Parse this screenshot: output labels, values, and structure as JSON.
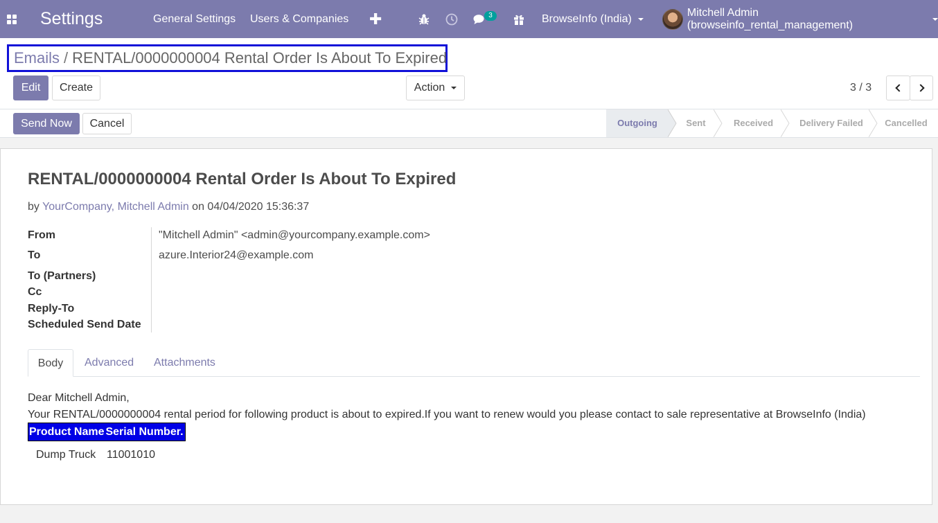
{
  "navbar": {
    "apps_icon": "apps-grid-icon",
    "brand": "Settings",
    "menus": [
      "General Settings",
      "Users & Companies"
    ],
    "plus_label": "✚",
    "systray": {
      "bug_icon": "bug-icon",
      "clock_icon": "clock-icon",
      "chat_icon": "chat-icon",
      "chat_badge": "3",
      "gift_icon": "gift-icon"
    },
    "company": "BrowseInfo (India)",
    "user": "Mitchell Admin (browseinfo_rental_management)"
  },
  "breadcrumb": {
    "parent": "Emails",
    "separator": "/",
    "current": "RENTAL/0000000004 Rental Order Is About To Expired"
  },
  "toolbar": {
    "edit_label": "Edit",
    "create_label": "Create",
    "action_label": "Action",
    "pager": "3 / 3"
  },
  "statusbar": {
    "send_label": "Send Now",
    "cancel_label": "Cancel",
    "stages": [
      "Outgoing",
      "Sent",
      "Received",
      "Delivery Failed",
      "Cancelled"
    ],
    "current_stage": "Outgoing"
  },
  "mail": {
    "subject": "RENTAL/0000000004 Rental Order Is About To Expired",
    "by_prefix": "by",
    "author": "YourCompany, Mitchell Admin",
    "on_prefix": "on",
    "date": "04/04/2020 15:36:37",
    "fields": {
      "from_label": "From",
      "from_value": "\"Mitchell Admin\" <admin@yourcompany.example.com>",
      "to_label": "To",
      "to_value": "azure.Interior24@example.com",
      "to_partners_label": "To (Partners)",
      "cc_label": "Cc",
      "reply_to_label": "Reply-To",
      "scheduled_label": "Scheduled Send Date"
    },
    "tabs": [
      "Body",
      "Advanced",
      "Attachments"
    ],
    "body": {
      "greeting": "Dear Mitchell Admin,",
      "message": "Your RENTAL/0000000004 rental period for following product is about to expired.If you want to renew would you please contact to sale representative at BrowseInfo (India)",
      "table_headers": [
        "Product Name",
        "Serial Number."
      ],
      "rows": [
        {
          "product": "Dump Truck",
          "serial": "11001010"
        }
      ]
    }
  },
  "colors": {
    "primary": "#7c7bad",
    "highlight_box": "#1010d8",
    "table_header_bg": "#0000e6",
    "badge": "#00a09d"
  }
}
